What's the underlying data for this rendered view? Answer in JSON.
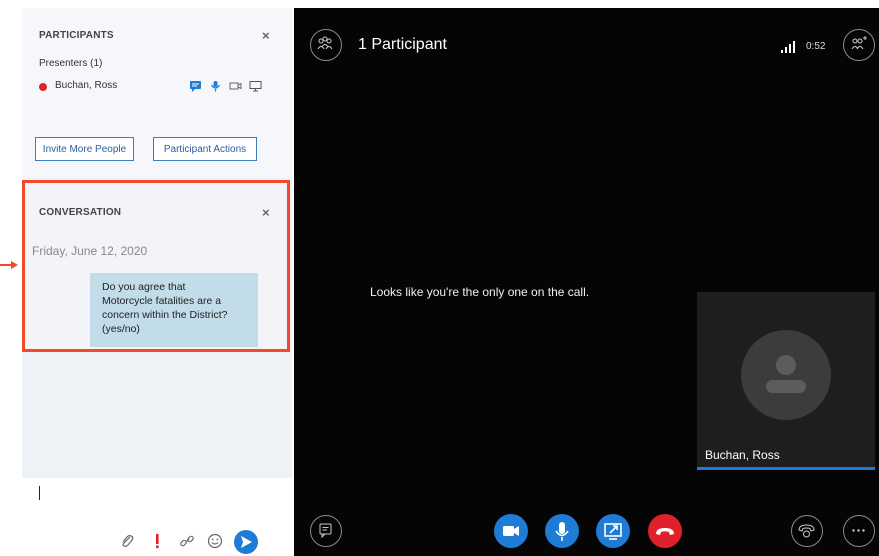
{
  "participants": {
    "title": "PARTICIPANTS",
    "presenters_label": "Presenters (1)",
    "people": [
      {
        "name": "Buchan, Ross",
        "status_color": "#e0202b"
      }
    ],
    "invite_button": "Invite More People",
    "actions_button": "Participant Actions"
  },
  "conversation": {
    "title": "CONVERSATION",
    "date": "Friday, June 12, 2020",
    "messages": [
      {
        "lines": [
          "Do you agree that",
          "Motorcycle fatalities are a",
          "concern within the District?",
          "(yes/no)"
        ]
      }
    ],
    "highlight_color": "#f04a2a"
  },
  "compose": {
    "icons": [
      "attach-icon",
      "importance-icon",
      "link-icon",
      "emoji-icon",
      "send-icon"
    ]
  },
  "call": {
    "title": "1 Participant",
    "timer": "0:52",
    "message": "Looks like you're the only one on the call.",
    "self_name": "Buchan, Ross",
    "controls": [
      "video-icon",
      "mic-icon",
      "share-screen-icon",
      "hang-up-icon"
    ],
    "colors": {
      "primary": "#1e7bd6",
      "hangup": "#e0202b"
    }
  }
}
